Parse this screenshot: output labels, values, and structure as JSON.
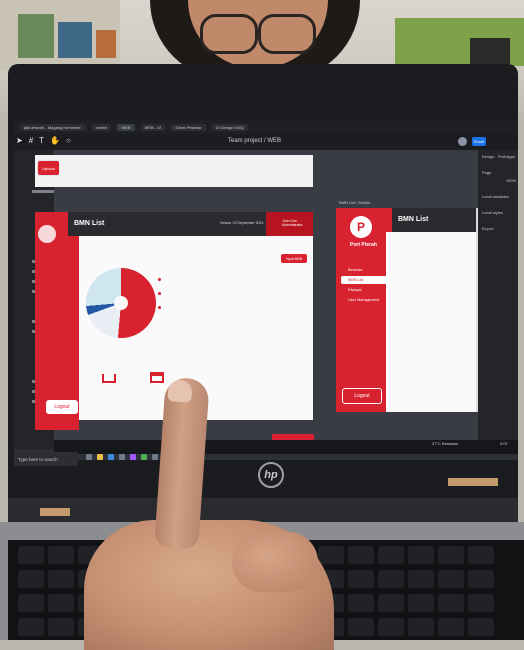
{
  "figma": {
    "tabs": [
      "jaki artwork - Magang Kementer.",
      "mobile",
      "WEB",
      "WEB - UI",
      "Sehat Pelamar",
      "UI Design KNIQ"
    ],
    "project_title": "Team project / WEB",
    "share_label": "Share",
    "right_panel": {
      "design_tab": "Design",
      "prototype_tab": "Prototype",
      "page_label": "Page",
      "zoom": "100%",
      "local_variables": "Local variables",
      "local_styles": "Local styles",
      "export": "Export"
    },
    "left_panel_hint": "1"
  },
  "frame1": {
    "upload_label": "Upload",
    "title": "BMN List",
    "date": "Selasa, 03 September 2024",
    "user_label": "John Doe\nAdministrator",
    "add_button": "Input BMN",
    "logout_label": "Logout"
  },
  "frame2": {
    "frame_label": "BMN List / Mobile",
    "logo_letter": "P",
    "brand": "Port Pterah",
    "title": "BMN List",
    "nav": [
      "Beranda",
      "BMN List",
      "Riwayat",
      "User Management"
    ],
    "logout_label": "Logout"
  },
  "taskbar": {
    "search_placeholder": "Type here to search",
    "weather": "27°C Berawan",
    "clock": "3:07"
  },
  "laptop": {
    "brand_mark": "hp"
  },
  "colors": {
    "accent": "#d8222f",
    "dark_header": "#2b2b2f",
    "figma_blue": "#1a73e8"
  },
  "chart": {
    "type": "donut",
    "slices": [
      0.51,
      0.18,
      0.04,
      0.27
    ]
  }
}
